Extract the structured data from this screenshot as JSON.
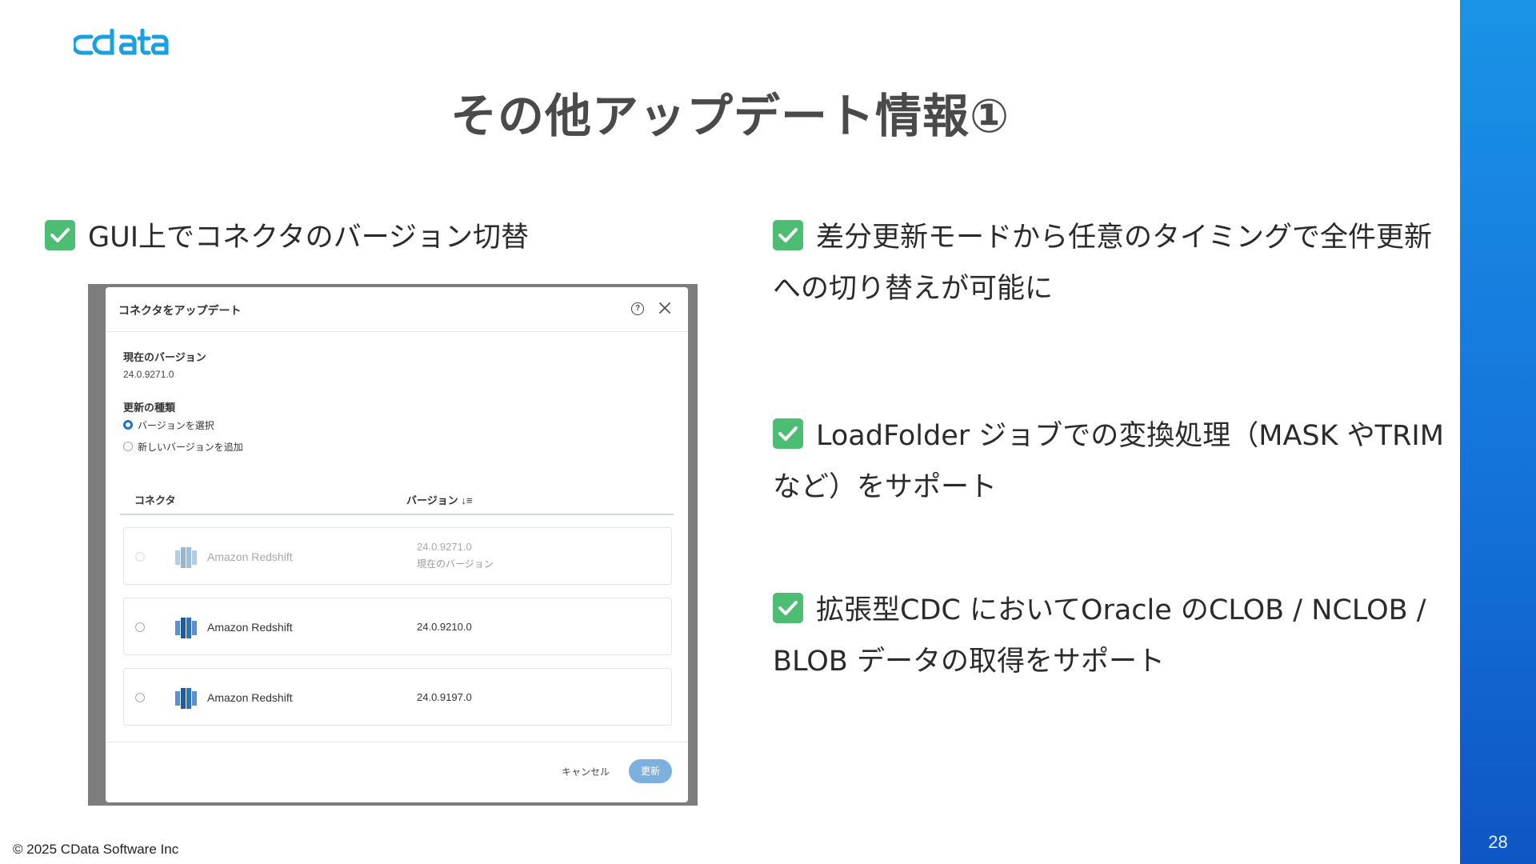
{
  "logo": {
    "text": "cdata",
    "color": "#1a9fe0"
  },
  "slide": {
    "title": "その他アップデート情報①",
    "page_number": "28",
    "copyright": "© 2025 CData Software Inc"
  },
  "bullets": [
    {
      "icon": "check-icon",
      "text": "GUI上でコネクタのバージョン切替"
    },
    {
      "icon": "check-icon",
      "text": "差分更新モードから任意のタイミングで全件更新への切り替えが可能に"
    },
    {
      "icon": "check-icon",
      "text": "LoadFolder ジョブでの変換処理（MASK やTRIM など）をサポート"
    },
    {
      "icon": "check-icon",
      "text": "拡張型CDC においてOracle のCLOB / NCLOB / BLOB データの取得をサポート"
    }
  ],
  "dialog": {
    "title": "コネクタをアップデート",
    "help_icon": "?",
    "current_version_label": "現在のバージョン",
    "current_version_value": "24.0.9271.0",
    "update_type_label": "更新の種類",
    "options": [
      {
        "label": "バージョンを選択",
        "selected": true
      },
      {
        "label": "新しいバージョンを追加",
        "selected": false
      }
    ],
    "columns": {
      "connector": "コネクタ",
      "version": "バージョン ↓≡"
    },
    "rows": [
      {
        "name": "Amazon Redshift",
        "version": "24.0.9271.0",
        "note": "現在のバージョン",
        "disabled": true
      },
      {
        "name": "Amazon Redshift",
        "version": "24.0.9210.0",
        "note": "",
        "disabled": false
      },
      {
        "name": "Amazon Redshift",
        "version": "24.0.9197.0",
        "note": "",
        "disabled": false
      }
    ],
    "cancel_label": "キャンセル",
    "update_label": "更新"
  },
  "colors": {
    "accent_blue": "#1473da",
    "check_green": "#4cbd72"
  }
}
